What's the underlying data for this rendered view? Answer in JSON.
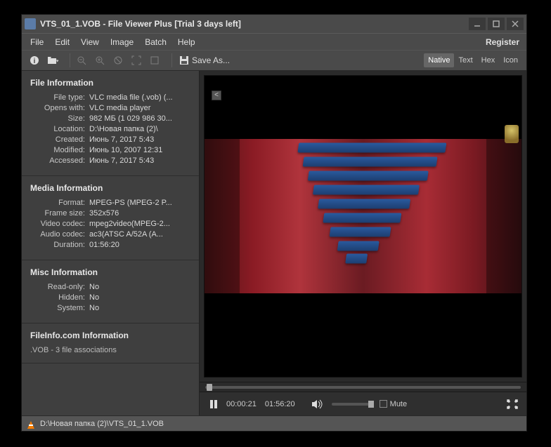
{
  "window": {
    "title": "VTS_01_1.VOB - File Viewer Plus [Trial 3 days left]"
  },
  "menu": {
    "items": [
      "File",
      "Edit",
      "View",
      "Image",
      "Batch",
      "Help"
    ],
    "register": "Register"
  },
  "toolbar": {
    "saveas": "Save As...",
    "viewmodes": [
      "Native",
      "Text",
      "Hex",
      "Icon"
    ]
  },
  "collapse_label": "<",
  "sidebar": {
    "file_info": {
      "title": "File Information",
      "rows": {
        "filetype_k": "File type:",
        "filetype_v": "VLC media file (.vob) (...",
        "opens_k": "Opens with:",
        "opens_v": "VLC media player",
        "size_k": "Size:",
        "size_v": "982 МБ (1 029 986 30...",
        "location_k": "Location:",
        "location_v": "D:\\Новая папка (2)\\",
        "created_k": "Created:",
        "created_v": "Июнь 7, 2017 5:43",
        "modified_k": "Modified:",
        "modified_v": "Июнь 10, 2007 12:31",
        "accessed_k": "Accessed:",
        "accessed_v": "Июнь 7, 2017 5:43"
      }
    },
    "media_info": {
      "title": "Media Information",
      "rows": {
        "format_k": "Format:",
        "format_v": "MPEG-PS (MPEG-2 P...",
        "frame_k": "Frame size:",
        "frame_v": "352x576",
        "vcodec_k": "Video codec:",
        "vcodec_v": "mpeg2video(MPEG-2...",
        "acodec_k": "Audio codec:",
        "acodec_v": "ac3(ATSC A/52A (A...",
        "duration_k": "Duration:",
        "duration_v": "01:56:20"
      }
    },
    "misc_info": {
      "title": "Misc Information",
      "rows": {
        "readonly_k": "Read-only:",
        "readonly_v": "No",
        "hidden_k": "Hidden:",
        "hidden_v": "No",
        "system_k": "System:",
        "system_v": "No"
      }
    },
    "fileinfo_com": {
      "title": "FileInfo.com Information",
      "sub": ".VOB - 3 file associations"
    }
  },
  "player": {
    "current": "00:00:21",
    "total": "01:56:20",
    "mute": "Mute"
  },
  "statusbar": {
    "path": "D:\\Новая папка (2)\\VTS_01_1.VOB"
  }
}
